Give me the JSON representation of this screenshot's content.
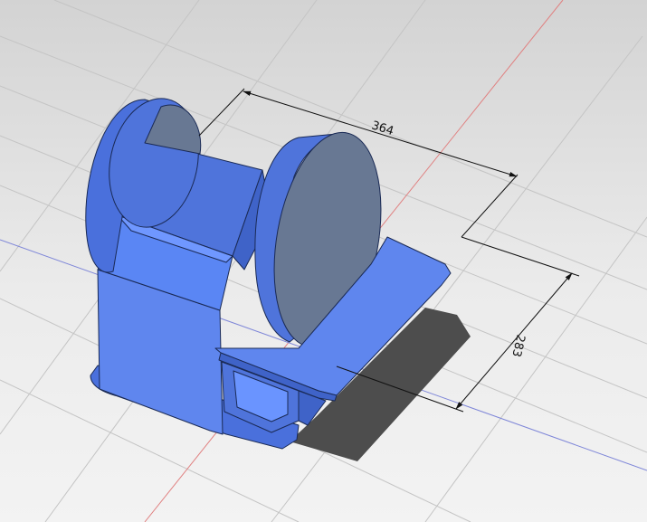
{
  "dimensions": {
    "width_label": "364",
    "height_label": "283"
  },
  "colors": {
    "background_top": "#d3d3d3",
    "background_bottom": "#f3f3f3",
    "grid_line": "#c4c4c4",
    "axis_x": "#e08080",
    "axis_y": "#7e86d8",
    "model_fill": "#5f86ee",
    "model_shade": "#4166cc",
    "model_dark": "#385bc0",
    "model_light": "#7aa0ff",
    "disc_face": "#687893",
    "shadow": "#4d4d4d",
    "dimension_line": "#111111"
  }
}
